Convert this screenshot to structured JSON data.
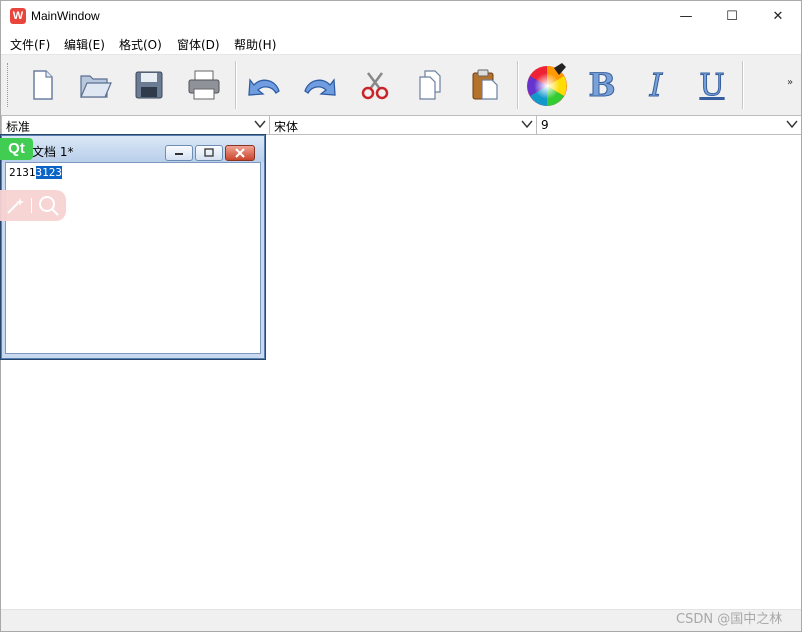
{
  "window": {
    "title": "MainWindow",
    "app_icon_glyph": "W"
  },
  "window_controls": {
    "minimize": "—",
    "maximize": "☐",
    "close": "✕"
  },
  "menu": [
    {
      "label": "文件(F)"
    },
    {
      "label": "编辑(E)"
    },
    {
      "label": "格式(O)"
    },
    {
      "label": "窗体(D)"
    },
    {
      "label": "帮助(H)"
    }
  ],
  "toolbar": {
    "icons": [
      "new-file-icon",
      "open-folder-icon",
      "save-disk-icon",
      "print-icon",
      "undo-icon",
      "redo-icon",
      "cut-scissors-icon",
      "copy-icon",
      "paste-icon",
      "color-wheel-icon",
      "bold-icon",
      "italic-icon",
      "underline-icon"
    ],
    "bold_glyph": "B",
    "italic_glyph": "I",
    "underline_glyph": "U",
    "overflow_glyph": "»"
  },
  "format_bar": {
    "style_value": "标准",
    "font_value": "宋体",
    "size_value": "9"
  },
  "child_window": {
    "title": "文档 1*",
    "text_plain": "2131",
    "text_selected": "3123"
  },
  "overlay": {
    "qt_badge": "Qt"
  },
  "watermark": "CSDN @国中之林",
  "colors": {
    "accent_select": "#0a64c8",
    "qt_green": "#41cd52",
    "app_icon_red": "#e8453c"
  }
}
